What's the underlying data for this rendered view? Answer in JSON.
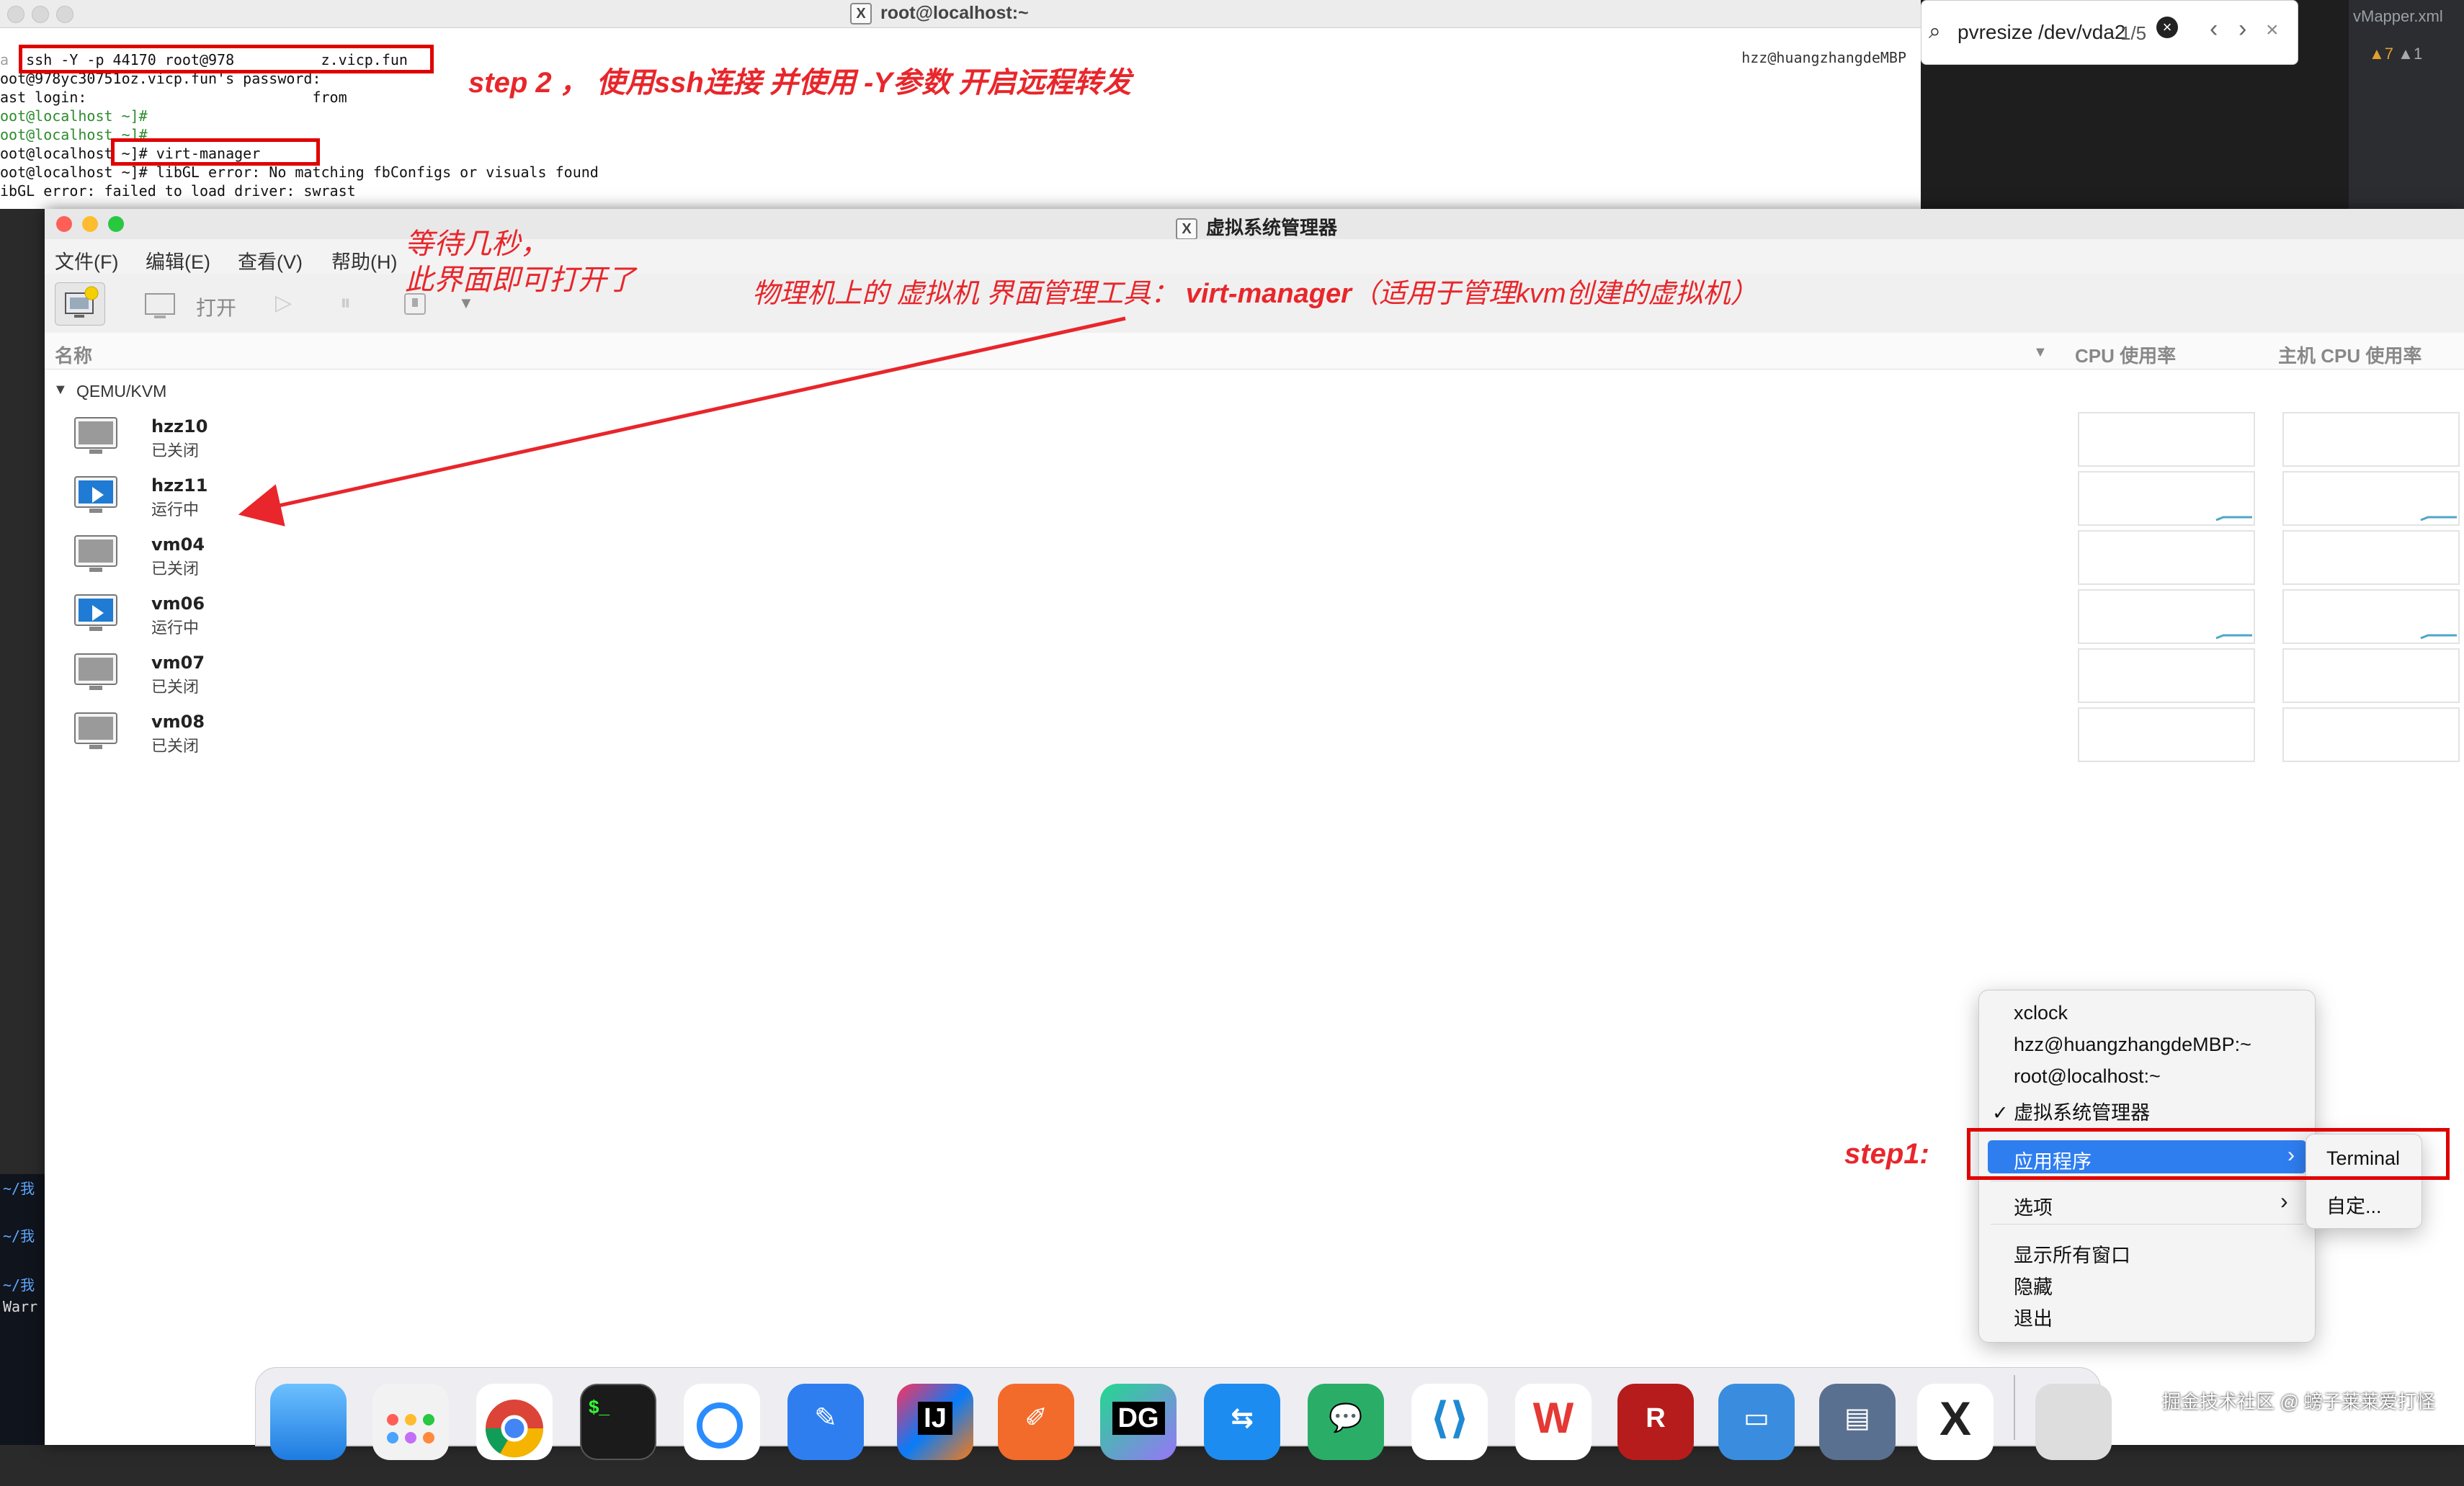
{
  "terminal": {
    "title": "root@localhost:~",
    "lines": [
      "ssh -Y -p 44170 root@978          z.vicp.fun",
      "oot@978yc30751oz.vicp.fun's password:",
      "ast login:                          from",
      "oot@localhost ~]#",
      "oot@localhost ~]#",
      "oot@localhost ~]# virt-manager",
      "oot@localhost ~]# libGL error: No matching fbConfigs or visuals found",
      "ibGL error: failed to load driver: swrast"
    ],
    "host_label": "hzz@huangzhangdeMBP"
  },
  "find_bar": {
    "query": "pvresize /dev/vda2",
    "count": "1/5"
  },
  "editor": {
    "tab": "vMapper.xml",
    "warnings": "7",
    "errors": "1"
  },
  "left_strip": [
    "~/我",
    "~/我",
    "~/我",
    "Warr"
  ],
  "annotations": {
    "step2": "step 2 ， 使用ssh连接 并使用 -Y参数 开启远程转发",
    "wait_line1": "等待几秒，",
    "wait_line2": "此界面即可打开了",
    "tool_desc_prefix": "物理机上的 虚拟机 界面管理工具：",
    "tool_desc_name": "virt-manager",
    "tool_desc_suffix": "（适用于管理kvm创建的虚拟机）",
    "step1": "step1:"
  },
  "virt_manager": {
    "title": "虚拟系统管理器",
    "menu": [
      "文件(F)",
      "编辑(E)",
      "查看(V)",
      "帮助(H)"
    ],
    "toolbar": {
      "open_label": "打开"
    },
    "columns": {
      "name": "名称",
      "cpu": "CPU 使用率",
      "host_cpu": "主机 CPU 使用率"
    },
    "group": "QEMU/KVM",
    "vms": [
      {
        "name": "hzz10",
        "state": "已关闭",
        "running": false
      },
      {
        "name": "hzz11",
        "state": "运行中",
        "running": true
      },
      {
        "name": "vm04",
        "state": "已关闭",
        "running": false
      },
      {
        "name": "vm06",
        "state": "运行中",
        "running": true
      },
      {
        "name": "vm07",
        "state": "已关闭",
        "running": false
      },
      {
        "name": "vm08",
        "state": "已关闭",
        "running": false
      }
    ]
  },
  "context_menu": {
    "windows": [
      "xclock",
      "hzz@huangzhangdeMBP:~",
      "root@localhost:~",
      "虚拟系统管理器"
    ],
    "applications": "应用程序",
    "options": "选项",
    "show_all": "显示所有窗口",
    "hide": "隐藏",
    "quit": "退出",
    "submenu": [
      "Terminal",
      "自定..."
    ]
  },
  "dock": {
    "labels": [
      "IJ",
      "DG"
    ],
    "watermark": "掘金技术社区 @ 螃子莱莱爱打怪"
  },
  "colors": {
    "annotation_red": "#e8262b",
    "highlight_blue": "#2f7ef0"
  }
}
